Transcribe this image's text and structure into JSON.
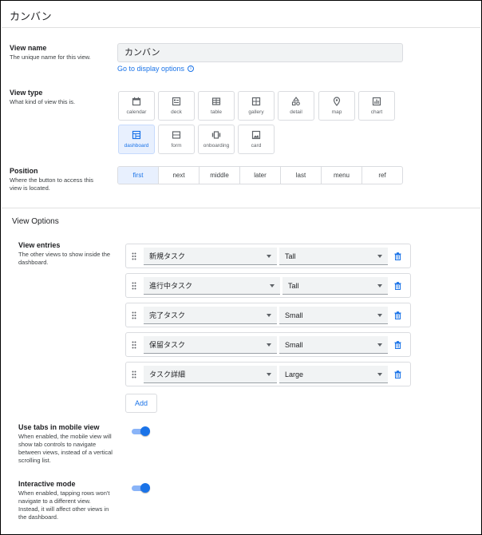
{
  "title": "カンバン",
  "view_name": {
    "label": "View name",
    "description": "The unique name for this view.",
    "value": "カンバン",
    "display_link": "Go to display options"
  },
  "view_type": {
    "label": "View type",
    "description": "What kind of view this is.",
    "options": [
      {
        "label": "calendar",
        "icon": "calendar-icon"
      },
      {
        "label": "deck",
        "icon": "deck-icon"
      },
      {
        "label": "table",
        "icon": "table-icon"
      },
      {
        "label": "gallery",
        "icon": "gallery-icon"
      },
      {
        "label": "detail",
        "icon": "detail-icon"
      },
      {
        "label": "map",
        "icon": "map-pin-icon"
      },
      {
        "label": "chart",
        "icon": "chart-icon"
      },
      {
        "label": "dashboard",
        "icon": "dashboard-icon",
        "selected": true
      },
      {
        "label": "form",
        "icon": "form-icon"
      },
      {
        "label": "onboarding",
        "icon": "onboarding-icon"
      },
      {
        "label": "card",
        "icon": "card-icon"
      }
    ]
  },
  "position": {
    "label": "Position",
    "description_lines": [
      "Where the button to access this",
      "view is located."
    ],
    "options": [
      "first",
      "next",
      "middle",
      "later",
      "last",
      "menu",
      "ref"
    ],
    "selected": "first"
  },
  "view_options": {
    "title": "View Options",
    "entries_label": "View entries",
    "entries_description_lines": [
      "The other views to show inside the",
      "dashboard."
    ],
    "entries": [
      {
        "view": "新規タスク",
        "size": "Tall"
      },
      {
        "view": "進行中タスク",
        "size": "Tall"
      },
      {
        "view": "完了タスク",
        "size": "Small"
      },
      {
        "view": "保留タスク",
        "size": "Small"
      },
      {
        "view": "タスク詳細",
        "size": "Large"
      }
    ],
    "add_label": "Add",
    "use_tabs": {
      "label": "Use tabs in mobile view",
      "description_lines": [
        "When enabled, the mobile view will",
        "show tab controls to navigate",
        "between views, instead of a vertical",
        "scrolling list."
      ],
      "enabled": true
    },
    "interactive": {
      "label": "Interactive mode",
      "description_lines": [
        "When enabled, tapping rows won't",
        "navigate to a different view.",
        "Instead, it will affect other views in",
        "the dashboard."
      ],
      "enabled": true
    }
  },
  "colors": {
    "accent": "#1a73e8",
    "selected_bg": "#e8f0fe",
    "input_bg": "#f1f3f4"
  }
}
